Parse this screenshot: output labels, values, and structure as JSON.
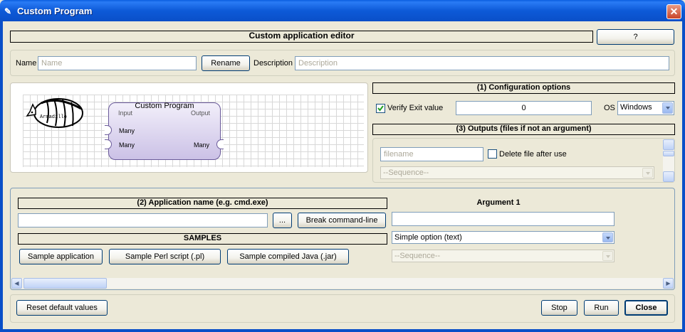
{
  "window": {
    "title": "Custom Program",
    "close_glyph": "✕"
  },
  "editor": {
    "header": "Custom application editor",
    "help_label": "?"
  },
  "name_row": {
    "name_label": "Name",
    "name_placeholder": "Name",
    "rename_label": "Rename",
    "description_label": "Description",
    "description_placeholder": "Description"
  },
  "canvas": {
    "logo_text": "Armadillo",
    "node": {
      "title": "Custom Program",
      "input_label": "Input",
      "output_label": "Output",
      "port1": "Many",
      "port2": "Many",
      "port3": "Many"
    }
  },
  "config": {
    "header": "(1) Configuration options",
    "verify_label": "Verify Exit value",
    "verify_checked": true,
    "exit_value": "0",
    "os_label": "OS",
    "os_value": "Windows"
  },
  "outputs": {
    "header": "(3) Outputs (files if not an argument)",
    "filename_placeholder": "filename",
    "delete_label": "Delete file after use",
    "sequence_value": "--Sequence--"
  },
  "application": {
    "header": "(2) Application name (e.g. cmd.exe)",
    "name_value": "",
    "browse_label": "...",
    "break_label": "Break command-line",
    "samples_header": "SAMPLES",
    "samples": [
      "Sample application",
      "Sample Perl script (.pl)",
      "Sample compiled Java (.jar)"
    ]
  },
  "argument": {
    "header": "Argument 1",
    "value": "",
    "type_value": "Simple option (text)",
    "sequence_value": "--Sequence--"
  },
  "footer": {
    "reset_label": "Reset default values",
    "stop_label": "Stop",
    "run_label": "Run",
    "close_label": "Close"
  },
  "icons": [
    "app-icon",
    "close-icon",
    "checkmark-icon",
    "chevron-down-icon",
    "scroll-left-icon",
    "scroll-right-icon",
    "scroll-up-icon",
    "scroll-down-icon",
    "armadillo-logo"
  ],
  "colors": {
    "titlebar": "#0a5ee0",
    "window_bg": "#ece9d8",
    "node_fill": "#cbc1e6",
    "node_border": "#6a5a9a"
  }
}
